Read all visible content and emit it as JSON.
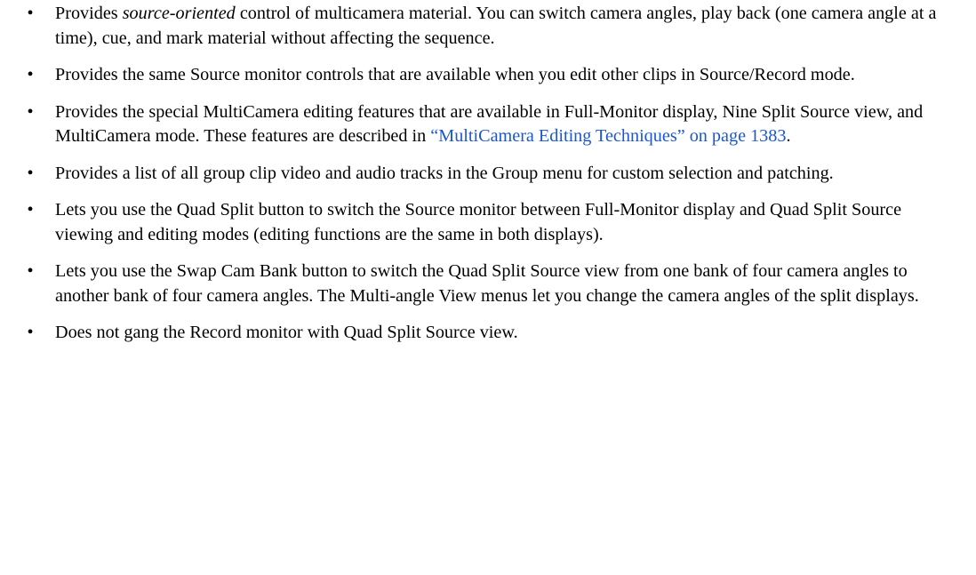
{
  "bullet_char": "•",
  "items": [
    {
      "pre": "Provides ",
      "em": "source-oriented",
      "post": " control of multicamera material. You can switch camera angles, play back (one camera angle at a time), cue, and mark material without affecting the sequence."
    },
    {
      "text": "Provides the same Source monitor controls that are available when you edit other clips in Source/Record mode."
    },
    {
      "pre": "Provides the special MultiCamera editing features that are available in Full-Monitor display, Nine Split Source view, and MultiCamera mode. These features are described in ",
      "link": "“MultiCamera Editing Techniques” on page 1383",
      "post": "."
    },
    {
      "text": "Provides a list of all group clip video and audio tracks in the Group menu for custom selection and patching."
    },
    {
      "text": "Lets you use the Quad Split button to switch the Source monitor between Full-Monitor display and Quad Split Source viewing and editing modes (editing functions are the same in both displays)."
    },
    {
      "text": "Lets you use the Swap Cam Bank button to switch the Quad Split Source view from one bank of four camera angles to another bank of four camera angles. The Multi-angle View menus let you change the camera angles of the split displays."
    },
    {
      "text": "Does not gang the Record monitor with Quad Split Source view."
    }
  ],
  "colors": {
    "text": "#000000",
    "link": "#1a56d6",
    "background": "#ffffff"
  }
}
